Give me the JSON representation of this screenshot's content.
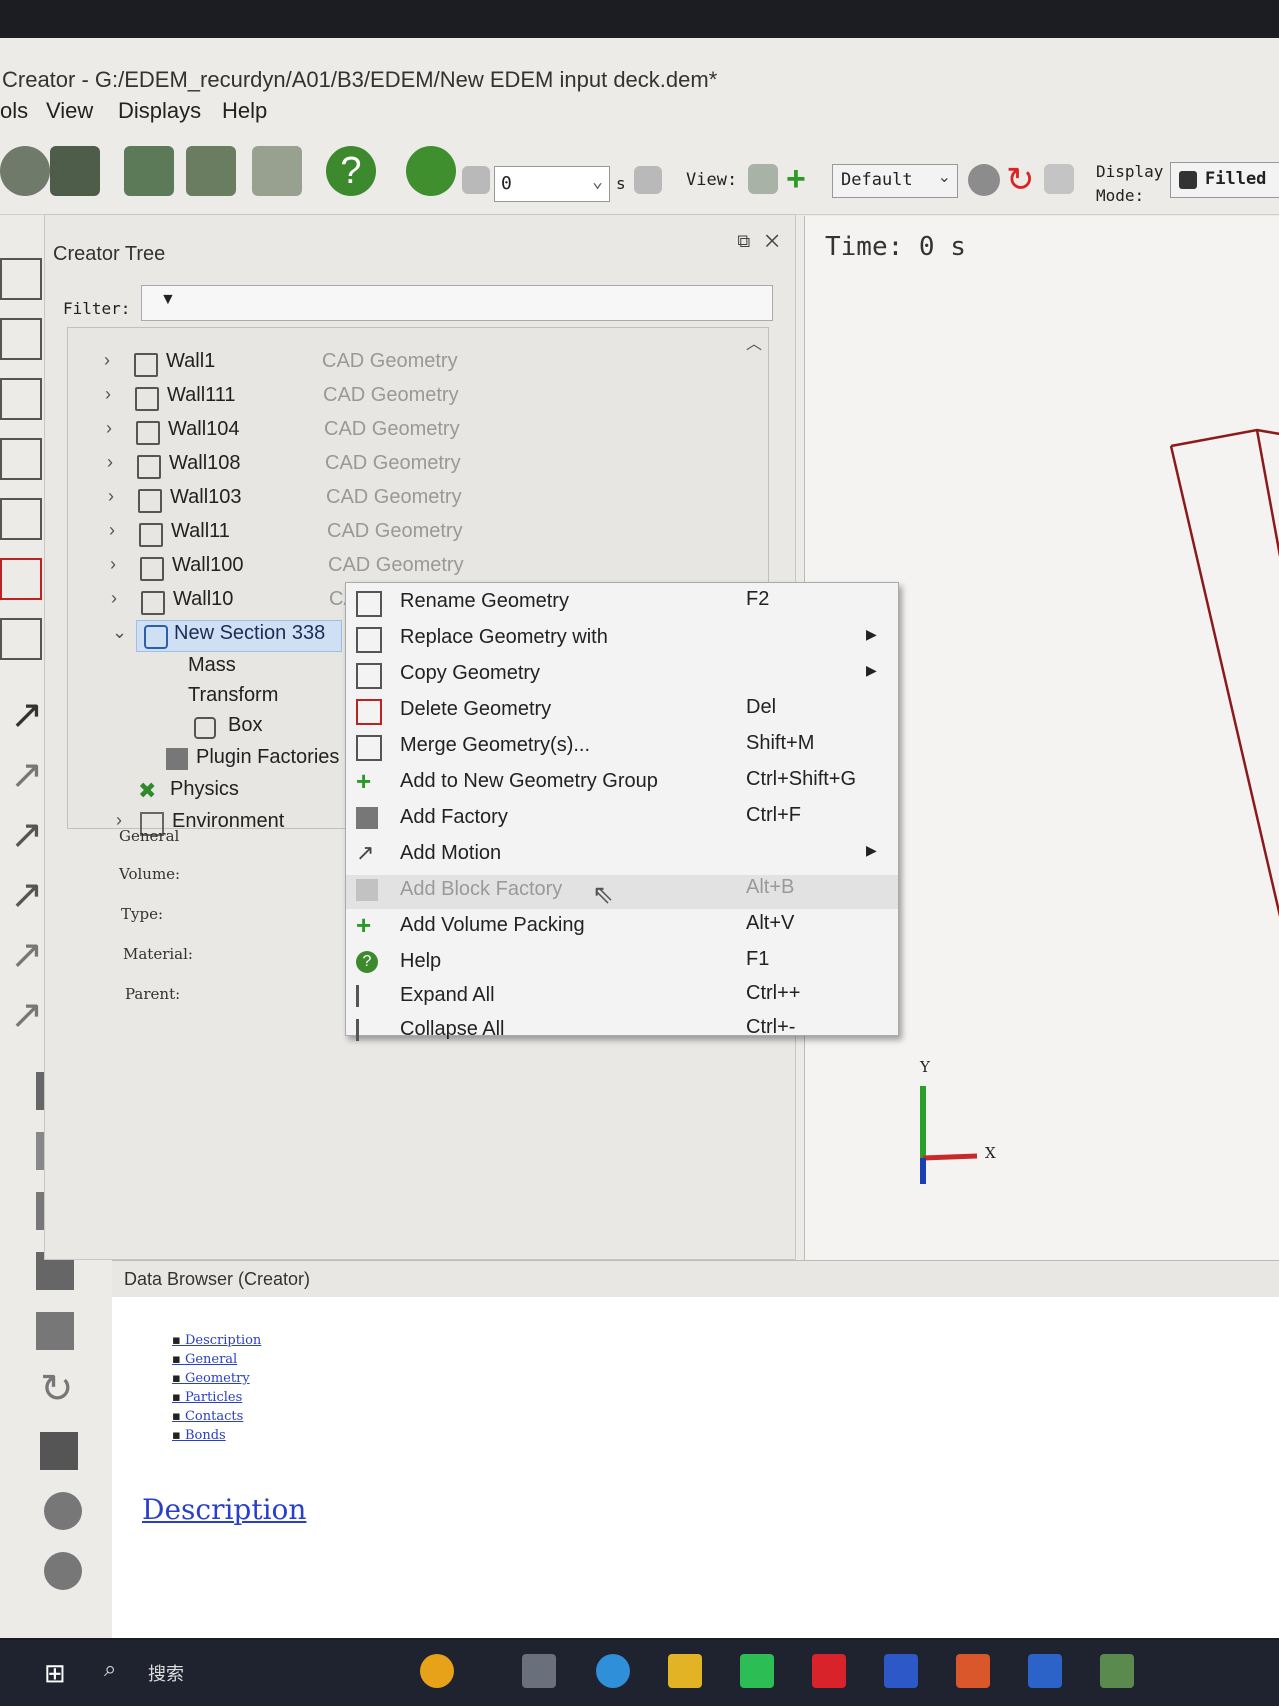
{
  "window": {
    "title": "Creator - G:/EDEM_recurdyn/A01/B3/EDEM/New EDEM input deck.dem*"
  },
  "menu": [
    "ols",
    "View",
    "Displays",
    "Help"
  ],
  "toolbar": {
    "frame_value": "0",
    "time_unit": "s",
    "view_label": "View:",
    "view_preset": "Default",
    "display_mode_label_1": "Display",
    "display_mode_label_2": "Mode:",
    "display_mode_value": "Filled"
  },
  "creator_panel": {
    "title": "Creator Tree",
    "filter_label": "Filter:",
    "tree": [
      {
        "name": "Wall1",
        "type": "CAD Geometry"
      },
      {
        "name": "Wall111",
        "type": "CAD Geometry"
      },
      {
        "name": "Wall104",
        "type": "CAD Geometry"
      },
      {
        "name": "Wall108",
        "type": "CAD Geometry"
      },
      {
        "name": "Wall103",
        "type": "CAD Geometry"
      },
      {
        "name": "Wall11",
        "type": "CAD Geometry"
      },
      {
        "name": "Wall100",
        "type": "CAD Geometry"
      },
      {
        "name": "Wall10",
        "type": "CAD Geometry"
      }
    ],
    "selected": "New Section 338",
    "children": {
      "mass": "Mass",
      "transform": "Transform",
      "box": "Box",
      "plugin": "Plugin Factories"
    },
    "physics": "Physics",
    "environment": "Environment",
    "props": {
      "general": "General",
      "volume": "Volume:",
      "type": "Type:",
      "material": "Material:",
      "parent": "Parent:"
    }
  },
  "viewport": {
    "time": "Time: 0 s",
    "axis_y": "Y",
    "axis_x": "X"
  },
  "context_menu": [
    {
      "label": "Rename Geometry",
      "shortcut": "F2"
    },
    {
      "label": "Replace Geometry with",
      "shortcut": ""
    },
    {
      "label": "Copy Geometry",
      "shortcut": ""
    },
    {
      "label": "Delete Geometry",
      "shortcut": "Del"
    },
    {
      "label": "Merge Geometry(s)...",
      "shortcut": "Shift+M"
    },
    {
      "label": "Add to New Geometry Group",
      "shortcut": "Ctrl+Shift+G"
    },
    {
      "label": "Add Factory",
      "shortcut": "Ctrl+F"
    },
    {
      "label": "Add Motion",
      "shortcut": ""
    },
    {
      "label": "Add Block Factory",
      "shortcut": "Alt+B"
    },
    {
      "label": "Add Volume Packing",
      "shortcut": "Alt+V"
    },
    {
      "label": "Help",
      "shortcut": "F1"
    },
    {
      "label": "Expand All",
      "shortcut": "Ctrl++"
    },
    {
      "label": "Collapse All",
      "shortcut": "Ctrl+-"
    }
  ],
  "data_browser": {
    "title": "Data Browser (Creator)",
    "links": [
      "Description",
      "General",
      "Geometry",
      "Particles",
      "Contacts",
      "Bonds"
    ],
    "heading": "Description"
  },
  "taskbar": {
    "search": "搜索"
  },
  "colors": {
    "accent": "#2a3fc7",
    "selection": "#cfe0f5",
    "wireframe": "#8b1a1a",
    "taskbar": "#1f2330"
  }
}
